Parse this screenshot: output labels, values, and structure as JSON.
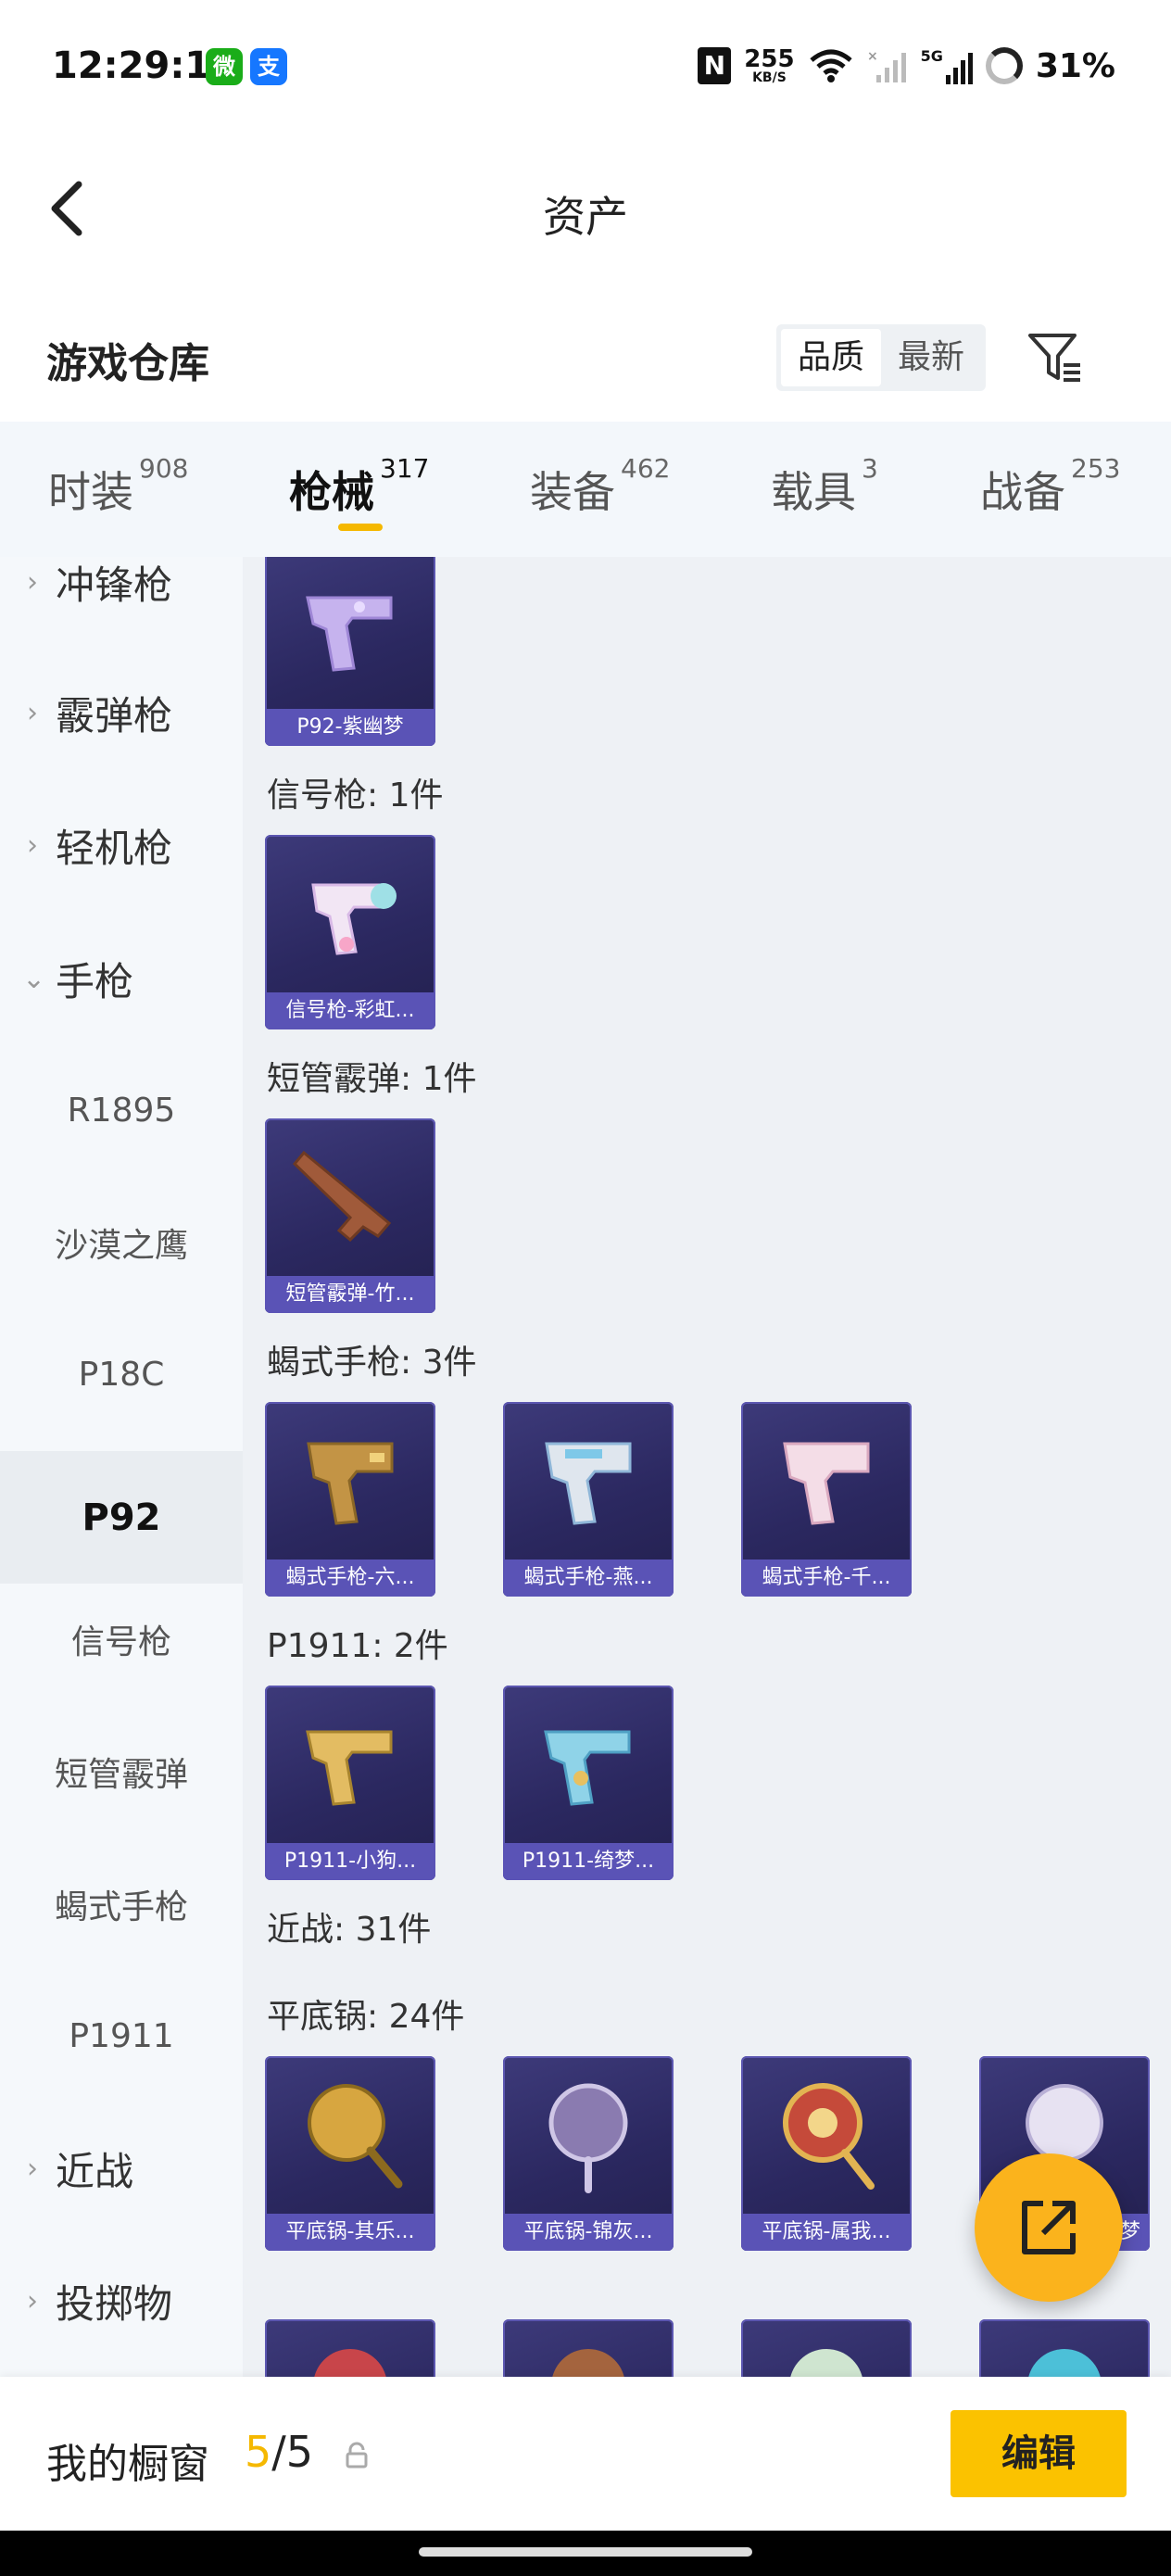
{
  "status_bar": {
    "time": "12:29:16",
    "app1_icon": "wechat-icon",
    "app1_glyph": "微",
    "app2_icon": "alipay-icon",
    "app2_glyph": "支",
    "nfc_glyph": "N",
    "net_speed": "255",
    "net_speed_unit": "KB/S",
    "cell_label": "5G",
    "battery": "31%"
  },
  "header": {
    "title": "资产",
    "back_icon": "chevron-left-icon"
  },
  "section": {
    "title": "游戏仓库",
    "sort_options": [
      "品质",
      "最新"
    ],
    "sort_selected": "品质",
    "filter_icon": "filter-icon"
  },
  "categories": [
    {
      "label": "时装",
      "count": "908"
    },
    {
      "label": "枪械",
      "count": "317",
      "active": true
    },
    {
      "label": "装备",
      "count": "462"
    },
    {
      "label": "载具",
      "count": "3"
    },
    {
      "label": "战备",
      "count": "253"
    }
  ],
  "subnav": [
    {
      "label": "冲锋枪",
      "type": "group"
    },
    {
      "label": "霰弹枪",
      "type": "group"
    },
    {
      "label": "轻机枪",
      "type": "group"
    },
    {
      "label": "手枪",
      "type": "group",
      "expanded": true
    },
    {
      "label": "R1895",
      "type": "sub"
    },
    {
      "label": "沙漠之鹰",
      "type": "sub"
    },
    {
      "label": "P18C",
      "type": "sub"
    },
    {
      "label": "P92",
      "type": "sub",
      "active": true
    },
    {
      "label": "信号枪",
      "type": "sub"
    },
    {
      "label": "短管霰弹",
      "type": "sub"
    },
    {
      "label": "蝎式手枪",
      "type": "sub"
    },
    {
      "label": "P1911",
      "type": "sub"
    },
    {
      "label": "近战",
      "type": "group"
    },
    {
      "label": "投掷物",
      "type": "group"
    }
  ],
  "groups": [
    {
      "label": "",
      "items": [
        "P92-紫幽梦"
      ]
    },
    {
      "label": "信号枪: 1件",
      "items": [
        "信号枪-彩虹..."
      ]
    },
    {
      "label": "短管霰弹: 1件",
      "items": [
        "短管霰弹-竹..."
      ]
    },
    {
      "label": "蝎式手枪: 3件",
      "items": [
        "蝎式手枪-六...",
        "蝎式手枪-燕...",
        "蝎式手枪-千..."
      ]
    },
    {
      "label": "P1911: 2件",
      "items": [
        "P1911-小狗...",
        "P1911-绮梦..."
      ]
    },
    {
      "label": "近战: 31件",
      "items": []
    },
    {
      "label": "平底锅: 24件",
      "items": [
        "平底锅-其乐...",
        "平底锅-锦灰...",
        "平底锅-属我...",
        "...梦"
      ]
    }
  ],
  "fab": {
    "icon": "share-external-icon"
  },
  "bottom_bar": {
    "showcase_label": "我的橱窗",
    "count_current": "5",
    "count_sep": "/",
    "count_total": "5",
    "lock_icon": "lock-icon",
    "edit_label": "编辑"
  }
}
